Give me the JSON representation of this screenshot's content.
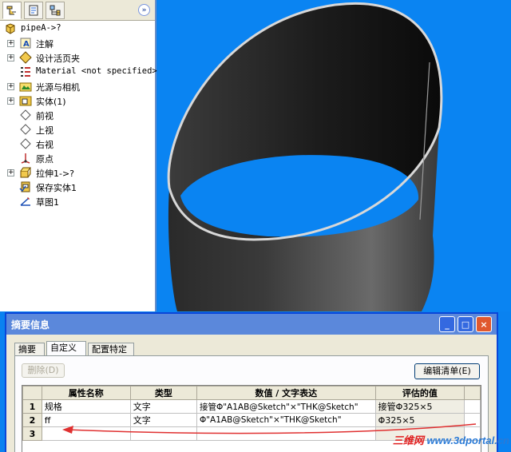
{
  "tree_panel": {
    "tabs": [
      "feature-manager",
      "property-manager",
      "configuration-manager"
    ],
    "collapse_label": "»",
    "root": "pipeA->?",
    "items": [
      {
        "label": "注解",
        "icon": "annotations-icon",
        "expandable": true
      },
      {
        "label": "设计活页夹",
        "icon": "design-binder-icon",
        "expandable": true
      },
      {
        "label": "Material <not specified>",
        "icon": "material-icon",
        "expandable": false
      },
      {
        "label": "光源与相机",
        "icon": "lights-cameras-icon",
        "expandable": true
      },
      {
        "label": "实体(1)",
        "icon": "solid-bodies-icon",
        "expandable": true
      },
      {
        "label": "前视",
        "icon": "plane-icon",
        "expandable": false
      },
      {
        "label": "上视",
        "icon": "plane-icon",
        "expandable": false
      },
      {
        "label": "右视",
        "icon": "plane-icon",
        "expandable": false
      },
      {
        "label": "原点",
        "icon": "origin-icon",
        "expandable": false
      },
      {
        "label": "拉伸1->?",
        "icon": "extrude-icon",
        "expandable": true
      },
      {
        "label": "保存实体1",
        "icon": "save-body-icon",
        "expandable": false
      },
      {
        "label": "草图1",
        "icon": "sketch-icon",
        "expandable": false
      }
    ]
  },
  "dialog": {
    "title": "摘要信息",
    "window_buttons": [
      "_",
      "□",
      "×"
    ],
    "tabs": [
      "摘要",
      "自定义",
      "配置特定"
    ],
    "active_tab": 1,
    "delete_label": "删除(D)",
    "edit_list_label": "编辑清单(E)",
    "columns": [
      "属性名称",
      "类型",
      "数值 / 文字表达",
      "评估的值"
    ],
    "rows": [
      {
        "num": "1",
        "name": "规格",
        "type": "文字",
        "value": "接管Φ\"A1AB@Sketch\"×\"THK@Sketch\"",
        "evaluated": "接管Φ325×5"
      },
      {
        "num": "2",
        "name": "ff",
        "type": "文字",
        "value": "Φ\"A1AB@Sketch\"×\"THK@Sketch\"",
        "evaluated": "Φ325×5"
      },
      {
        "num": "3",
        "name": "",
        "type": "",
        "value": "",
        "evaluated": ""
      }
    ]
  },
  "watermark": {
    "cn": "三维网",
    "url": "www.3dportal.cn"
  },
  "colors": {
    "viewport_bg": "#0a84f2",
    "titlebar": "#5b88db",
    "annotation_arrow": "#e03030"
  }
}
